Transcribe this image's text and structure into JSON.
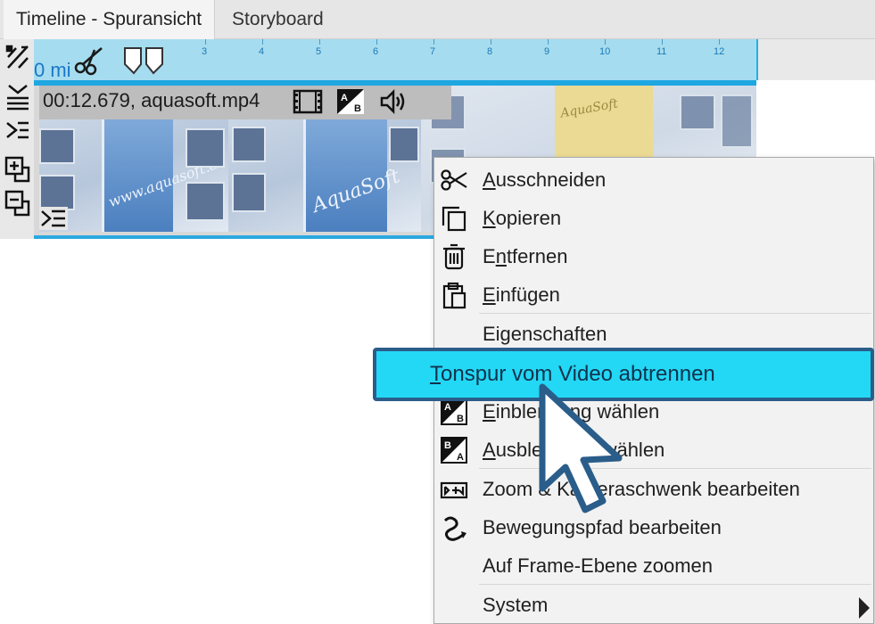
{
  "tabs": [
    {
      "label": "Timeline - Spuransicht",
      "active": true
    },
    {
      "label": "Storyboard",
      "active": false
    }
  ],
  "ruler": {
    "unit_fragment": "0 mi",
    "ticks": [
      "3",
      "4",
      "5",
      "6",
      "7",
      "8",
      "9",
      "10",
      "11",
      "12"
    ]
  },
  "clip": {
    "label": "00:12.679,  aquasoft.mp4",
    "thumb_text_1": "AquaSoft",
    "thumb_text_2": "AquaSoft",
    "thumb_text_3": "www.aquasoft.de"
  },
  "menu": {
    "items": [
      {
        "label": "Ausschneiden",
        "underline": "A",
        "icon": "scissors-icon"
      },
      {
        "label": "Kopieren",
        "underline": "K",
        "icon": "copy-icon"
      },
      {
        "label": "Entfernen",
        "underline": "n",
        "icon": "trash-icon"
      },
      {
        "label": "Einfügen",
        "underline": "E",
        "icon": "paste-icon"
      },
      {
        "label": "Eigenschaften",
        "icon": ""
      },
      {
        "label": "Tonspur vom Video abtrennen",
        "underline": "T",
        "highlighted": true
      },
      {
        "label": "Einblendung wählen",
        "underline": "E",
        "icon": "fade-in-icon"
      },
      {
        "label": "Ausblendung wählen",
        "underline": "A",
        "icon": "fade-out-icon"
      },
      {
        "label": "Zoom & Kameraschwenk bearbeiten",
        "icon": "zoom-camera-icon"
      },
      {
        "label": "Bewegungspfad bearbeiten",
        "icon": "motion-path-icon"
      },
      {
        "label": "Auf Frame-Ebene zoomen",
        "icon": ""
      },
      {
        "label": "System",
        "icon": "",
        "submenu": true
      }
    ]
  },
  "colors": {
    "ruler": "#a6dcef",
    "accent": "#1ea7e1",
    "highlight": "#22d8f5",
    "highlight_border": "#2a5d8a"
  }
}
